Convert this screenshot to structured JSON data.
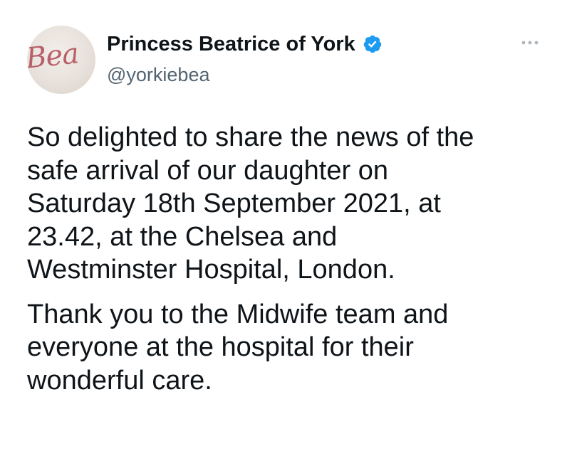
{
  "author": {
    "display_name": "Princess Beatrice of York",
    "handle": "@yorkiebea",
    "avatar_text": "Bea",
    "verified": true
  },
  "tweet": {
    "paragraphs": [
      [
        "So delighted to share the news of the",
        "safe arrival of our daughter on",
        "Saturday 18th September 2021, at",
        "23.42, at the Chelsea and",
        "Westminster Hospital, London."
      ],
      [
        "Thank you to the Midwife team and",
        "everyone at the hospital for their",
        "wonderful care."
      ]
    ]
  },
  "icons": {
    "verified": "verified-badge-icon",
    "more": "more-options-icon"
  },
  "colors": {
    "verified_blue": "#1d9bf0",
    "text": "#0f1419",
    "secondary_text": "#536471",
    "avatar_script": "#b8606a"
  }
}
